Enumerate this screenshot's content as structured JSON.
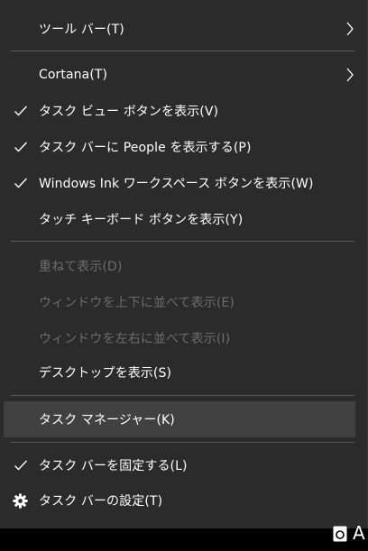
{
  "menu": {
    "items": [
      {
        "label": "ツール バー(T)",
        "has_submenu": true
      },
      {
        "label": "Cortana(T)",
        "has_submenu": true
      },
      {
        "label": "タスク ビュー ボタンを表示(V)",
        "checked": true
      },
      {
        "label": "タスク バーに People を表示する(P)",
        "checked": true
      },
      {
        "label": "Windows Ink ワークスペース ボタンを表示(W)",
        "checked": true
      },
      {
        "label": "タッチ キーボード ボタンを表示(Y)"
      },
      {
        "label": "重ねて表示(D)",
        "disabled": true
      },
      {
        "label": "ウィンドウを上下に並べて表示(E)",
        "disabled": true
      },
      {
        "label": "ウィンドウを左右に並べて表示(I)",
        "disabled": true
      },
      {
        "label": "デスクトップを表示(S)"
      },
      {
        "label": "タスク マネージャー(K)",
        "highlighted": true
      },
      {
        "label": "タスク バーを固定する(L)",
        "checked": true
      },
      {
        "label": "タスク バーの設定(T)",
        "icon": "gear-icon"
      }
    ]
  },
  "taskbar": {
    "tray_letter": "A"
  },
  "colors": {
    "menu_bg": "#2b2b2b",
    "text": "#ffffff",
    "disabled_text": "#6d6d6d",
    "highlight_bg": "#414141",
    "separator": "#5a5a5a"
  }
}
